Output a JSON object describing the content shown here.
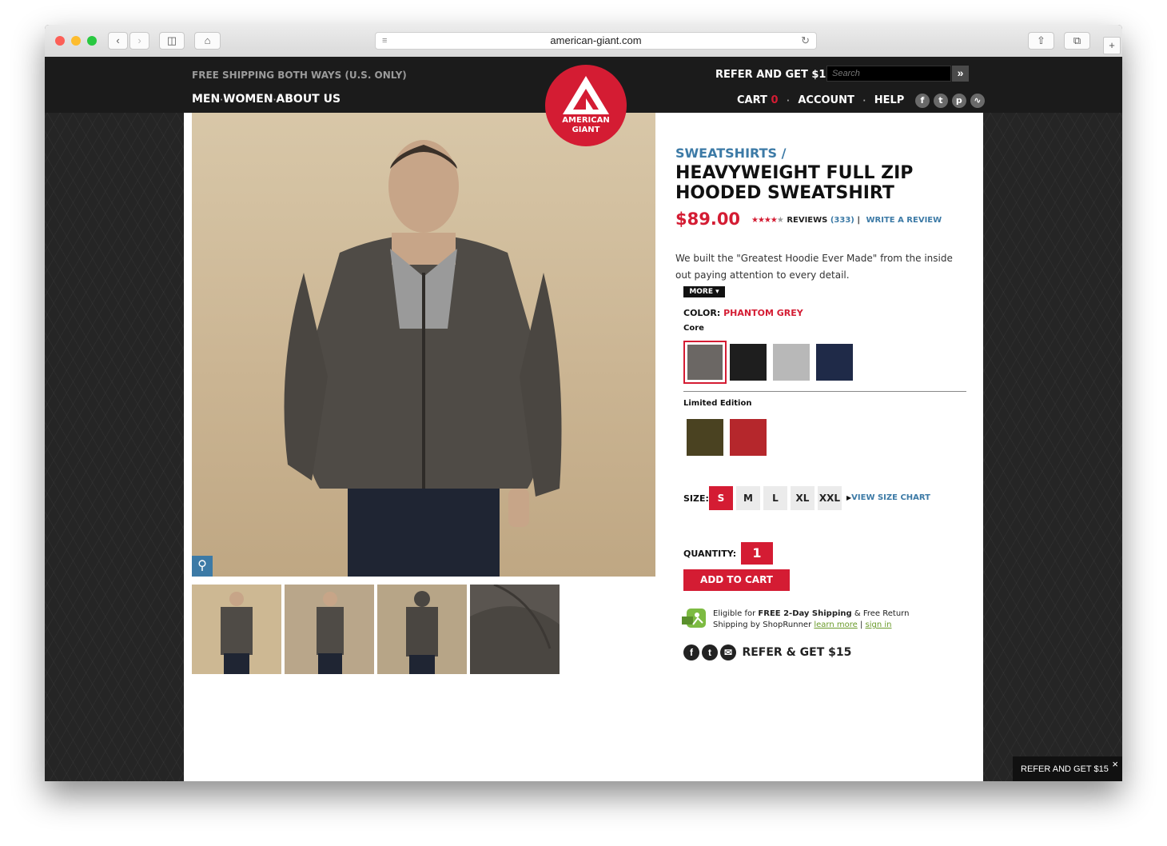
{
  "browser": {
    "url": "american-giant.com"
  },
  "header": {
    "shipping_notice": "FREE SHIPPING BOTH WAYS (U.S. ONLY)",
    "nav": [
      "MEN",
      "WOMEN",
      "ABOUT US"
    ],
    "refer": "REFER AND GET $15",
    "search_placeholder": "Search",
    "cart_label": "CART",
    "cart_count": "0",
    "account": "ACCOUNT",
    "help": "HELP",
    "logo_line1": "AMERICAN",
    "logo_line2": "GIANT",
    "social_icons": [
      "facebook-icon",
      "twitter-icon",
      "pinterest-icon",
      "rss-icon"
    ]
  },
  "product": {
    "category": "SWEATSHIRTS /",
    "title_line1": "HEAVYWEIGHT FULL ZIP",
    "title_line2": "HOODED SWEATSHIRT",
    "price": "$89.00",
    "rating": 4,
    "reviews_label": "REVIEWS",
    "reviews_count": "(333)",
    "write_review": "WRITE A REVIEW",
    "description": "We built the \"Greatest Hoodie Ever Made\" from the inside out paying attention to every detail.",
    "more_label": "MORE",
    "color_label": "COLOR:",
    "color_value": "PHANTOM GREY",
    "core_label": "Core",
    "core_colors": [
      "#6b6764",
      "#1e1e1e",
      "#b8b8b8",
      "#1f2a48"
    ],
    "limited_label": "Limited Edition",
    "limited_colors": [
      "#4a4221",
      "#b5272c"
    ],
    "size_label": "SIZE:",
    "sizes": [
      "S",
      "M",
      "L",
      "XL",
      "XXL"
    ],
    "selected_size": "S",
    "size_chart": "VIEW SIZE CHART",
    "quantity_label": "QUANTITY:",
    "quantity": "1",
    "add_to_cart": "ADD TO CART",
    "shoprunner_prefix": "Eligible for",
    "shoprunner_bold": "FREE 2-Day Shipping",
    "shoprunner_mid": "& Free Return",
    "shoprunner_line2": "Shipping by ShopRunner",
    "learn_more": "learn more",
    "sign_in": "sign in",
    "refer_share": "REFER & GET $15"
  },
  "popup": {
    "refer": "REFER AND GET $15",
    "close": "×"
  },
  "colors": {
    "accent_red": "#d41c33",
    "link_blue": "#3c7aa6",
    "header_bg": "#1b1b1b"
  }
}
